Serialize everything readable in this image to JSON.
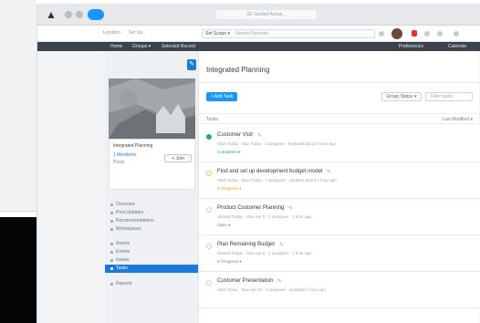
{
  "browser": {
    "address": "SF Guided Action..."
  },
  "app_header": {
    "left_label_1": "Location",
    "left_label_2": "Set Up",
    "search_scope": "Set Scope ▾",
    "search_placeholder": "Search Records"
  },
  "nav": {
    "items": [
      "Home",
      "Groups ▾",
      "Selected Record"
    ],
    "right_items": [
      "Preferences",
      "Calendar"
    ]
  },
  "left_panel": {
    "card_title": "Integrated Planning",
    "followers": "1 Members",
    "sub": "Posts",
    "follow_label": "+ Join",
    "menu": [
      {
        "label": "Overview",
        "active": false
      },
      {
        "label": "Post Updates",
        "active": false
      },
      {
        "label": "Recommendations",
        "active": false
      },
      {
        "label": "Workspaces",
        "active": false
      },
      {
        "label": "Assets",
        "active": false
      },
      {
        "label": "Events",
        "active": false
      },
      {
        "label": "Issues",
        "active": false
      },
      {
        "label": "Tasks",
        "active": true
      },
      {
        "label": "Reports",
        "active": false
      }
    ]
  },
  "main": {
    "title": "Integrated Planning",
    "add_label": "+ Add Task",
    "sort_label": "Group Status ▾",
    "filter_placeholder": "Filter tasks",
    "list_head_left": "Tasks",
    "list_head_right": "Last Modified ▾",
    "tasks": [
      {
        "title": "Customer Visit",
        "meta": "Start Today · Due Today · 1 assignee · Updated about 1 hour ago",
        "state": "Completed ▾",
        "status": "done"
      },
      {
        "title": "Find and set up development budget model",
        "meta": "Start Today · Due Friday · 1 assignee · Updated about 1 hour ago",
        "state": "In Progress ▾",
        "status": "pending"
      },
      {
        "title": "Product Customer Planning",
        "meta": "Started Friday · Due Apr 5 · 1 assignee · 1 hour ago",
        "state": "Open ▾",
        "status": "open"
      },
      {
        "title": "Plan Remaining Budget",
        "meta": "Started Friday · Due Apr 5 · 1 assignee · 1 hour ago",
        "state": "In Progress ▾",
        "status": "open"
      },
      {
        "title": "Customer Presentation",
        "meta": "Start Today · Due Apr 15 · 1 assignee · Updated 1 hour ago",
        "state": "",
        "status": "open"
      }
    ]
  },
  "colors": {
    "accent": "#1b96ff",
    "nav": "#3d434c",
    "done": "#1fae6b",
    "in_progress": "#e0a800"
  }
}
